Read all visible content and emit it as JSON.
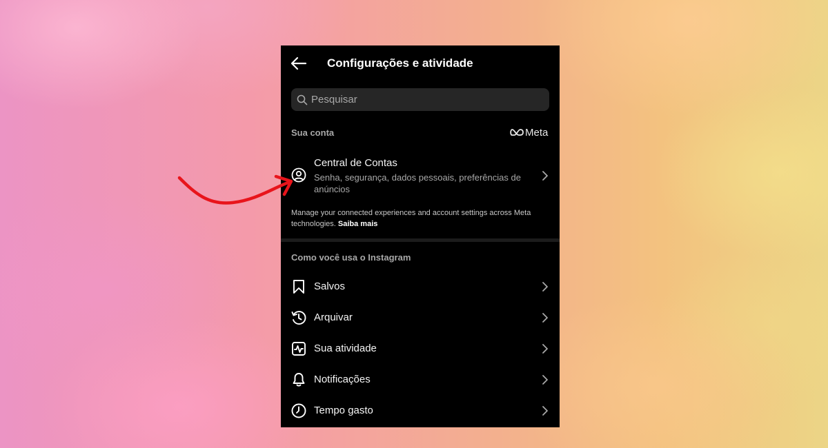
{
  "header": {
    "title": "Configurações e atividade"
  },
  "search": {
    "placeholder": "Pesquisar"
  },
  "account_section": {
    "label": "Sua conta",
    "brand": "Meta",
    "accounts_center": {
      "title": "Central de Contas",
      "subtitle": "Senha, segurança, dados pessoais, preferências de anúncios"
    },
    "note": "Manage your connected experiences and account settings across Meta technologies.",
    "note_link": "Saiba mais"
  },
  "usage_section": {
    "label": "Como você usa o Instagram",
    "items": [
      {
        "label": "Salvos",
        "icon": "bookmark-icon"
      },
      {
        "label": "Arquivar",
        "icon": "archive-icon"
      },
      {
        "label": "Sua atividade",
        "icon": "activity-icon"
      },
      {
        "label": "Notificações",
        "icon": "bell-icon"
      },
      {
        "label": "Tempo gasto",
        "icon": "clock-icon"
      }
    ]
  },
  "colors": {
    "panel_bg": "#000000",
    "search_bg": "#262626",
    "secondary_text": "#a8a8a8",
    "annotation_arrow": "#e8141b"
  }
}
